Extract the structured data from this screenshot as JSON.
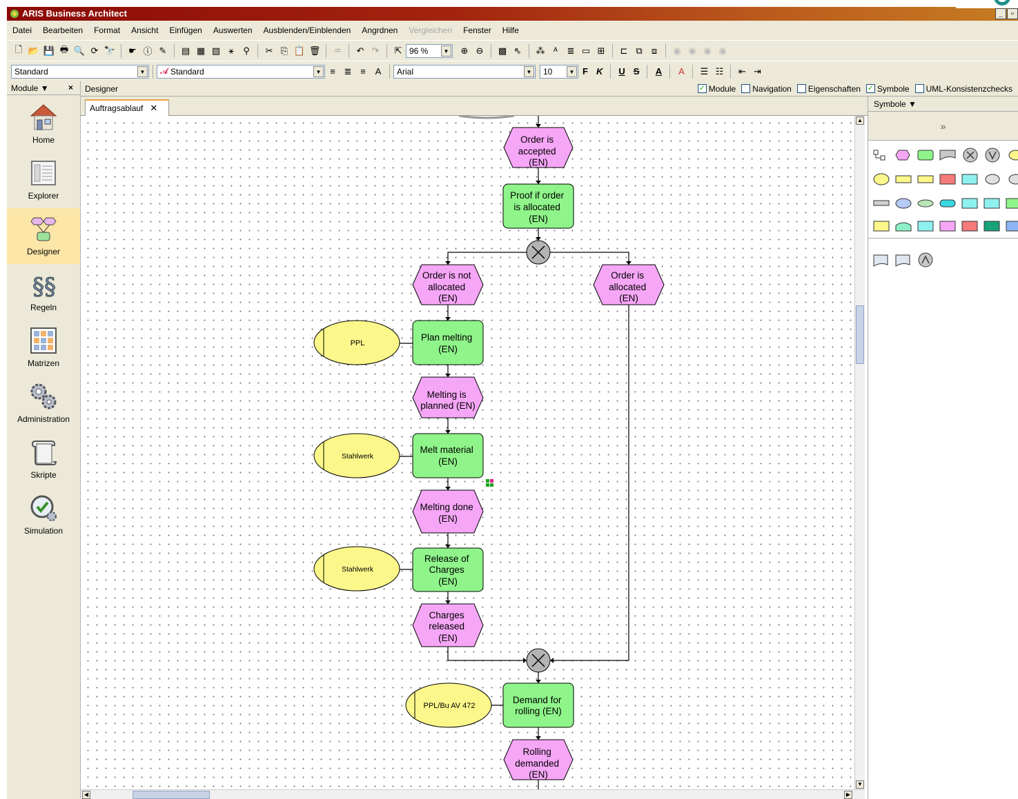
{
  "window": {
    "title": "ARIS Business Architect"
  },
  "menu": [
    "Datei",
    "Bearbeiten",
    "Format",
    "Ansicht",
    "Einfügen",
    "Auswerten",
    "Ausblenden/Einblenden",
    "Angrdnen",
    "Vergleichen",
    "Fenster",
    "Hilfe"
  ],
  "menu_disabled": [
    "Vergleichen"
  ],
  "toolbar": {
    "zoom": "96 %"
  },
  "format_bar": {
    "style1": "Standard",
    "style2": "Standard",
    "font": "Arial",
    "size": "10",
    "bold": "F",
    "italic": "K",
    "underline": "U",
    "strike": "S"
  },
  "left_panel": {
    "header": "Module",
    "modules": [
      {
        "label": "Home",
        "icon": "home-icon"
      },
      {
        "label": "Explorer",
        "icon": "explorer-icon"
      },
      {
        "label": "Designer",
        "icon": "designer-icon",
        "selected": true
      },
      {
        "label": "Regeln",
        "icon": "rules-icon"
      },
      {
        "label": "Matrizen",
        "icon": "matrix-icon"
      },
      {
        "label": "Administration",
        "icon": "gears-icon"
      },
      {
        "label": "Skripte",
        "icon": "scroll-icon"
      },
      {
        "label": "Simulation",
        "icon": "simulation-icon"
      }
    ]
  },
  "designer": {
    "title": "Designer",
    "checks": [
      {
        "label": "Module",
        "checked": true
      },
      {
        "label": "Navigation",
        "checked": false
      },
      {
        "label": "Eigenschaften",
        "checked": false
      },
      {
        "label": "Symbole",
        "checked": true
      },
      {
        "label": "UML-Konsistenzchecks",
        "checked": false
      }
    ],
    "tab": "Auftragsablauf"
  },
  "symbols_panel": {
    "header": "Symbole"
  },
  "diagram": {
    "nodes": [
      {
        "type": "event",
        "lines": [
          "Order is",
          "accepted",
          "(EN)"
        ]
      },
      {
        "type": "function",
        "lines": [
          "Proof if order",
          "is allocated",
          "(EN)"
        ]
      },
      {
        "type": "xor",
        "lines": []
      },
      {
        "type": "event",
        "lines": [
          "Order is not",
          "allocated",
          "(EN)"
        ]
      },
      {
        "type": "event",
        "lines": [
          "Order is",
          "allocated",
          "(EN)"
        ]
      },
      {
        "type": "function",
        "lines": [
          "Plan melting",
          "(EN)"
        ]
      },
      {
        "type": "org",
        "lines": [
          "PPL"
        ]
      },
      {
        "type": "event",
        "lines": [
          "Melting is",
          "planned (EN)"
        ]
      },
      {
        "type": "function",
        "lines": [
          "Melt material",
          "(EN)"
        ]
      },
      {
        "type": "org",
        "lines": [
          "Stahlwerk"
        ]
      },
      {
        "type": "event",
        "lines": [
          "Melting done",
          "(EN)"
        ]
      },
      {
        "type": "function",
        "lines": [
          "Release of",
          "Charges",
          "(EN)"
        ]
      },
      {
        "type": "org",
        "lines": [
          "Stahlwerk"
        ]
      },
      {
        "type": "event",
        "lines": [
          "Charges",
          "released",
          "(EN)"
        ]
      },
      {
        "type": "xor",
        "lines": []
      },
      {
        "type": "function",
        "lines": [
          "Demand for",
          "rolling (EN)"
        ]
      },
      {
        "type": "org",
        "lines": [
          "PPL/Bu AV 472"
        ]
      },
      {
        "type": "event",
        "lines": [
          "Rolling",
          "demanded",
          "(EN)"
        ]
      }
    ]
  }
}
